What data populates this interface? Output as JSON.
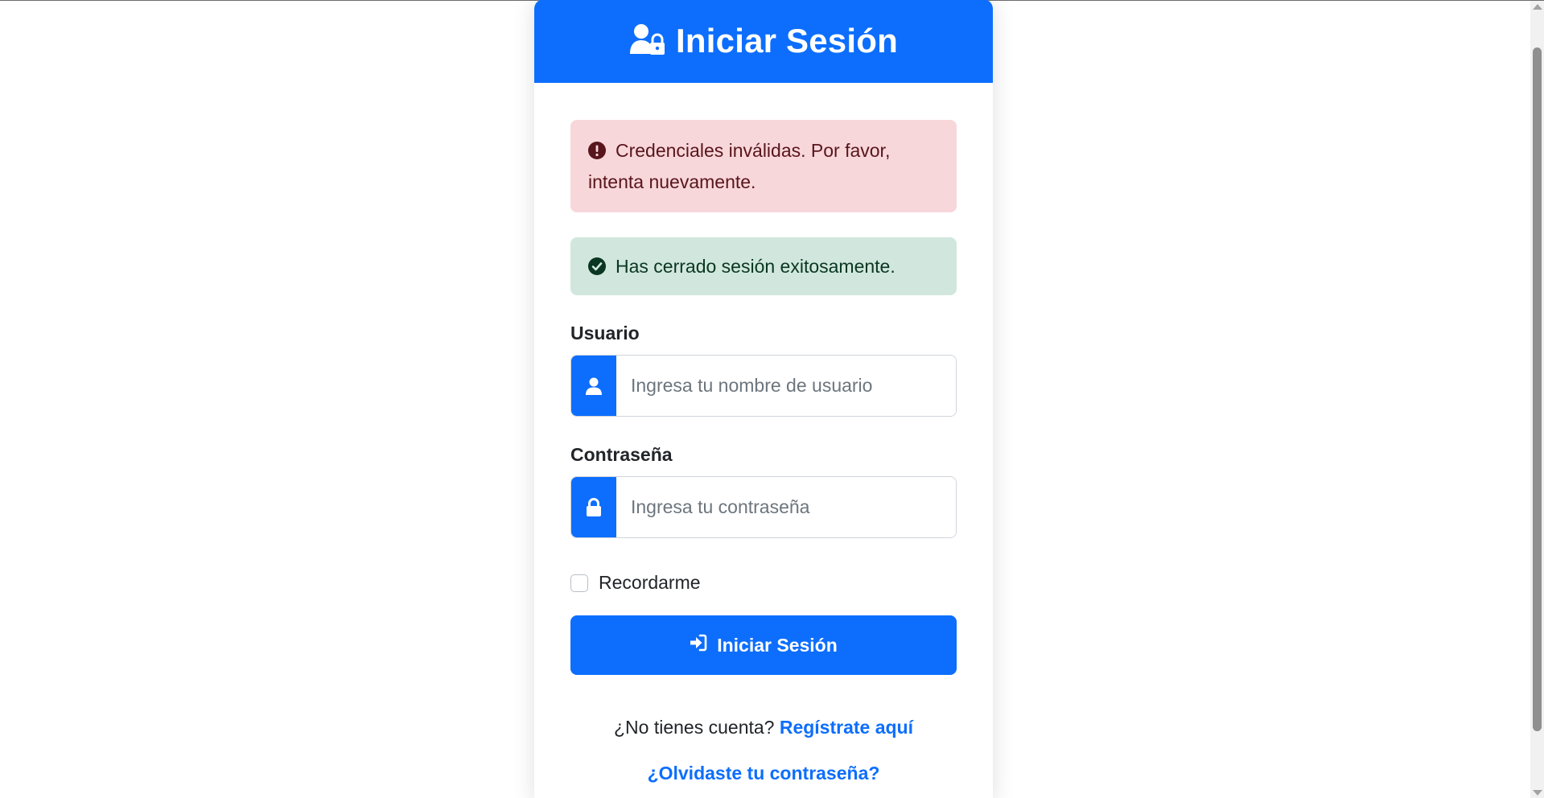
{
  "colors": {
    "primary": "#0d6efd",
    "danger_bg": "#f8d7da",
    "danger_text": "#58151c",
    "success_bg": "#d1e7dd",
    "success_text": "#0a3622"
  },
  "header": {
    "icon": "user-lock-icon",
    "title": "Iniciar Sesión"
  },
  "alerts": {
    "error": {
      "icon": "exclamation-circle-icon",
      "text": "Credenciales inválidas. Por favor, intenta nuevamente."
    },
    "success": {
      "icon": "check-circle-icon",
      "text": "Has cerrado sesión exitosamente."
    }
  },
  "form": {
    "username": {
      "label": "Usuario",
      "icon": "user-icon",
      "value": "",
      "placeholder": "Ingresa tu nombre de usuario"
    },
    "password": {
      "label": "Contraseña",
      "icon": "lock-icon",
      "value": "",
      "placeholder": "Ingresa tu contraseña"
    },
    "remember": {
      "label": "Recordarme",
      "checked": false
    },
    "submit": {
      "icon": "sign-in-icon",
      "label": "Iniciar Sesión"
    }
  },
  "footer": {
    "no_account_text": "¿No tienes cuenta?",
    "register_link": "Regístrate aquí",
    "forgot_link": "¿Olvidaste tu contraseña?"
  }
}
